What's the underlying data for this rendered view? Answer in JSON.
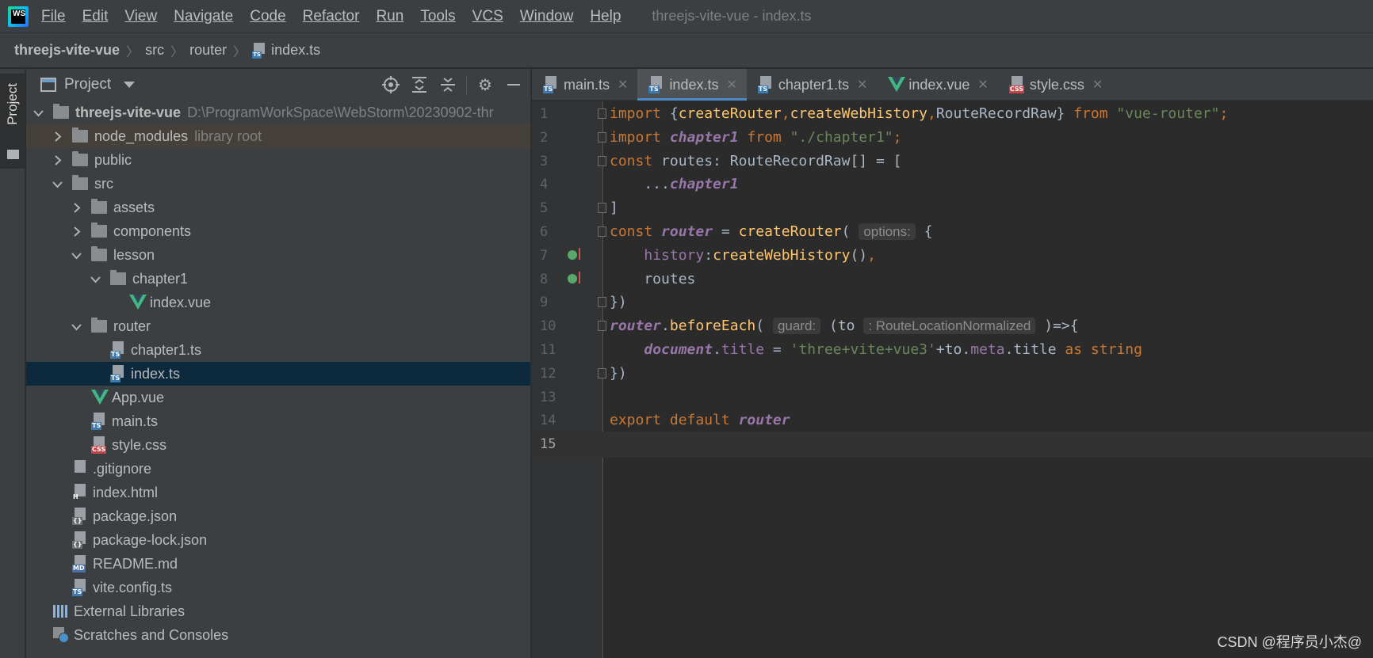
{
  "menubar": {
    "app_logo_text": "WS",
    "items": [
      "File",
      "Edit",
      "View",
      "Navigate",
      "Code",
      "Refactor",
      "Run",
      "Tools",
      "VCS",
      "Window",
      "Help"
    ],
    "window_title": "threejs-vite-vue - index.ts"
  },
  "breadcrumb": {
    "items": [
      "threejs-vite-vue",
      "src",
      "router",
      "index.ts"
    ],
    "file_badge": "TS"
  },
  "toolstrip": {
    "project_label": "Project"
  },
  "project_panel": {
    "title": "Project",
    "tools": [
      "crosshair-icon",
      "expand-all-icon",
      "collapse-all-icon",
      "gear-icon",
      "minimize-icon"
    ],
    "tree": [
      {
        "label": "threejs-vite-vue",
        "extra": "D:\\ProgramWorkSpace\\WebStorm\\20230902-thr",
        "kind": "folder",
        "depth": 0,
        "expanded": true
      },
      {
        "label": "node_modules",
        "extra": "library root",
        "kind": "folder",
        "depth": 1,
        "expanded": false
      },
      {
        "label": "public",
        "kind": "folder",
        "depth": 1,
        "expanded": false
      },
      {
        "label": "src",
        "kind": "folder",
        "depth": 1,
        "expanded": true
      },
      {
        "label": "assets",
        "kind": "folder",
        "depth": 2,
        "expanded": false
      },
      {
        "label": "components",
        "kind": "folder",
        "depth": 2,
        "expanded": false
      },
      {
        "label": "lesson",
        "kind": "folder",
        "depth": 2,
        "expanded": true
      },
      {
        "label": "chapter1",
        "kind": "folder",
        "depth": 3,
        "expanded": true
      },
      {
        "label": "index.vue",
        "kind": "vue",
        "depth": 4
      },
      {
        "label": "router",
        "kind": "folder",
        "depth": 2,
        "expanded": true
      },
      {
        "label": "chapter1.ts",
        "kind": "ts",
        "depth": 3
      },
      {
        "label": "index.ts",
        "kind": "ts",
        "depth": 3,
        "selected": true
      },
      {
        "label": "App.vue",
        "kind": "vue",
        "depth": 2
      },
      {
        "label": "main.ts",
        "kind": "ts",
        "depth": 2
      },
      {
        "label": "style.css",
        "kind": "css",
        "depth": 2
      },
      {
        "label": ".gitignore",
        "kind": "file",
        "depth": 1
      },
      {
        "label": "index.html",
        "kind": "html",
        "depth": 1
      },
      {
        "label": "package.json",
        "kind": "json",
        "depth": 1
      },
      {
        "label": "package-lock.json",
        "kind": "json",
        "depth": 1
      },
      {
        "label": "README.md",
        "kind": "md",
        "depth": 1
      },
      {
        "label": "vite.config.ts",
        "kind": "ts",
        "depth": 1
      },
      {
        "label": "External Libraries",
        "kind": "libs",
        "depth": 0
      },
      {
        "label": "Scratches and Consoles",
        "kind": "scratch",
        "depth": 0
      }
    ],
    "badges": {
      "ts": "TS",
      "css": "CSS",
      "html": "H",
      "json": "{}",
      "md": "MD"
    }
  },
  "tabs": [
    {
      "label": "main.ts",
      "kind": "ts",
      "active": false
    },
    {
      "label": "index.ts",
      "kind": "ts",
      "active": true
    },
    {
      "label": "chapter1.ts",
      "kind": "ts",
      "active": false
    },
    {
      "label": "index.vue",
      "kind": "vue",
      "active": false
    },
    {
      "label": "style.css",
      "kind": "css",
      "active": false
    }
  ],
  "editor": {
    "current_line": 15,
    "lines": [
      {
        "n": "1",
        "fold": true,
        "tokens": [
          [
            "kw",
            "import "
          ],
          [
            "",
            "{"
          ],
          [
            "fn",
            "createRouter"
          ],
          [
            "kw",
            ","
          ],
          [
            "fn",
            "createWebHistory"
          ],
          [
            "kw",
            ","
          ],
          [
            "",
            "RouteRecordRaw} "
          ],
          [
            "kw",
            "from "
          ],
          [
            "str",
            "\"vue-router\""
          ],
          [
            "kw",
            ";"
          ]
        ]
      },
      {
        "n": "2",
        "fold": true,
        "tokens": [
          [
            "kw",
            "import "
          ],
          [
            "iv",
            "chapter1"
          ],
          [
            "kw",
            " from "
          ],
          [
            "str",
            "\"./chapter1\""
          ],
          [
            "kw",
            ";"
          ]
        ]
      },
      {
        "n": "3",
        "fold": true,
        "tokens": [
          [
            "kw",
            "const "
          ],
          [
            "",
            "routes: RouteRecordRaw[] = ["
          ]
        ]
      },
      {
        "n": "4",
        "tokens": [
          [
            "",
            "    ..."
          ],
          [
            "iv",
            "chapter1"
          ]
        ]
      },
      {
        "n": "5",
        "fold": true,
        "tokens": [
          [
            "",
            "]"
          ]
        ]
      },
      {
        "n": "6",
        "fold": true,
        "tokens": [
          [
            "kw",
            "const "
          ],
          [
            "iv",
            "router"
          ],
          [
            "",
            " = "
          ],
          [
            "fn",
            "createRouter"
          ],
          [
            "",
            "( "
          ],
          [
            "hint",
            "options:"
          ],
          [
            "",
            " {"
          ]
        ]
      },
      {
        "n": "7",
        "marker": true,
        "tokens": [
          [
            "",
            "    "
          ],
          [
            "fld",
            "history"
          ],
          [
            "",
            ":"
          ],
          [
            "fn",
            "createWebHistory"
          ],
          [
            "",
            "()"
          ],
          [
            "kw",
            ","
          ]
        ]
      },
      {
        "n": "8",
        "marker": true,
        "tokens": [
          [
            "",
            "    routes"
          ]
        ]
      },
      {
        "n": "9",
        "fold": true,
        "tokens": [
          [
            "",
            "})"
          ]
        ]
      },
      {
        "n": "10",
        "fold": true,
        "tokens": [
          [
            "iv",
            "router"
          ],
          [
            "",
            "."
          ],
          [
            "fn",
            "beforeEach"
          ],
          [
            "",
            "( "
          ],
          [
            "hint",
            "guard:"
          ],
          [
            "",
            " (to "
          ],
          [
            "hint",
            ": RouteLocationNormalized"
          ],
          [
            "",
            " )=>{"
          ]
        ]
      },
      {
        "n": "11",
        "tokens": [
          [
            "",
            "    "
          ],
          [
            "iv",
            "document"
          ],
          [
            "",
            "."
          ],
          [
            "fld",
            "title"
          ],
          [
            "",
            " = "
          ],
          [
            "str",
            "'three+vite+vue3'"
          ],
          [
            "",
            "+to."
          ],
          [
            "fld",
            "meta"
          ],
          [
            "",
            ".title "
          ],
          [
            "kw",
            "as string"
          ]
        ]
      },
      {
        "n": "12",
        "fold": true,
        "tokens": [
          [
            "",
            "})"
          ]
        ]
      },
      {
        "n": "13",
        "tokens": []
      },
      {
        "n": "14",
        "tokens": [
          [
            "kw",
            "export default "
          ],
          [
            "iv",
            "router"
          ]
        ]
      },
      {
        "n": "15",
        "tokens": []
      }
    ]
  },
  "watermark": "CSDN @程序员小杰@"
}
